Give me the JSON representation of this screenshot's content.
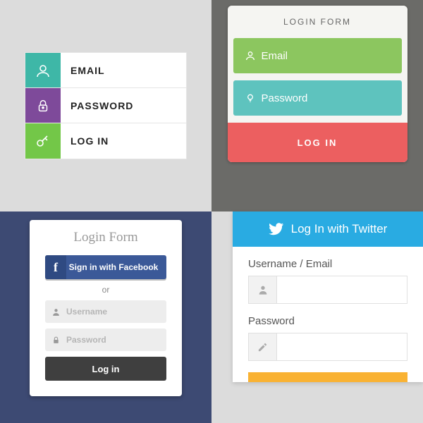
{
  "form1": {
    "email_label": "EMAIL",
    "password_label": "PASSWORD",
    "login_label": "LOG IN"
  },
  "form2": {
    "title": "LOGIN FORM",
    "email_placeholder": "Email",
    "password_placeholder": "Password",
    "login_label": "LOG IN"
  },
  "form3": {
    "title": "Login Form",
    "facebook_label": "Sign in with Facebook",
    "facebook_f": "f",
    "or_label": "or",
    "username_placeholder": "Username",
    "password_placeholder": "Password",
    "login_label": "Log in"
  },
  "form4": {
    "twitter_label": "Log In with Twitter",
    "username_label": "Username / Email",
    "password_label": "Password"
  }
}
